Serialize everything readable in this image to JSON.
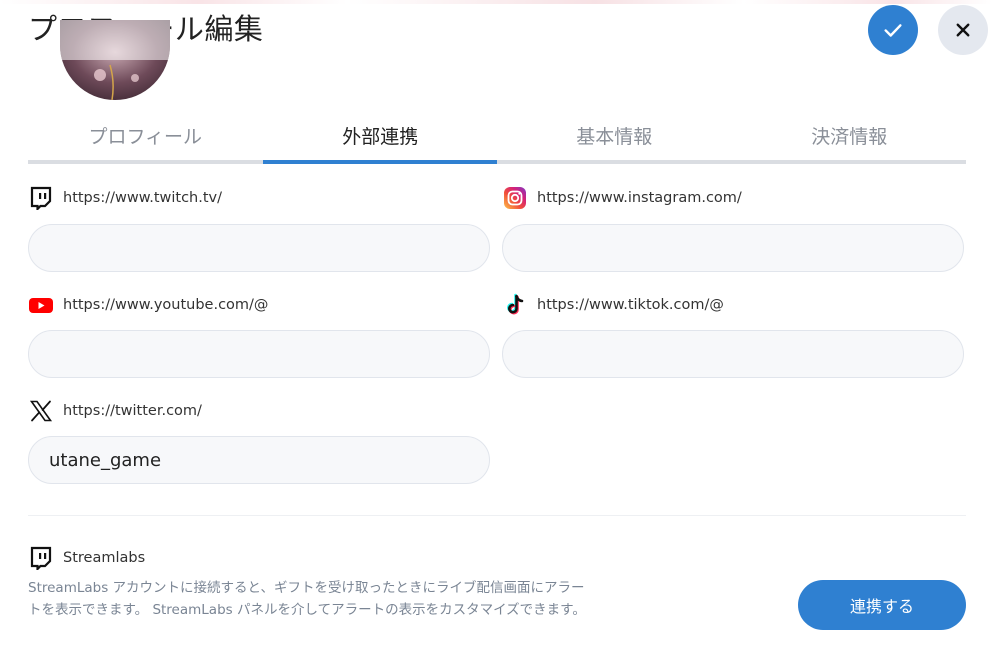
{
  "header": {
    "title": "プロフィール編集",
    "confirm_icon": "check-icon",
    "close_icon": "close-icon"
  },
  "tabs": [
    {
      "label": "プロフィール",
      "active": false
    },
    {
      "label": "外部連携",
      "active": true
    },
    {
      "label": "基本情報",
      "active": false
    },
    {
      "label": "決済情報",
      "active": false
    }
  ],
  "fields": {
    "twitch": {
      "icon": "twitch-icon",
      "label": "https://www.twitch.tv/",
      "value": ""
    },
    "instagram": {
      "icon": "instagram-icon",
      "label": "https://www.instagram.com/",
      "value": ""
    },
    "youtube": {
      "icon": "youtube-icon",
      "label": "https://www.youtube.com/@",
      "value": ""
    },
    "tiktok": {
      "icon": "tiktok-icon",
      "label": "https://www.tiktok.com/@",
      "value": ""
    },
    "twitter": {
      "icon": "x-icon",
      "label": "https://twitter.com/",
      "value": "utane_game"
    }
  },
  "streamlabs": {
    "icon": "twitch-icon",
    "label": "Streamlabs",
    "description_line1": "StreamLabs アカウントに接続すると、ギフトを受け取ったときにライブ配信画面にアラー",
    "description_line2": "トを表示できます。 StreamLabs パネルを介してアラートの表示をカスタマイズできます。",
    "button_label": "連携する"
  },
  "colors": {
    "accent": "#2f80d1",
    "tab_inactive": "#8a8f98",
    "input_bg": "#f7f8fa",
    "close_bg": "#e4e8ef"
  }
}
